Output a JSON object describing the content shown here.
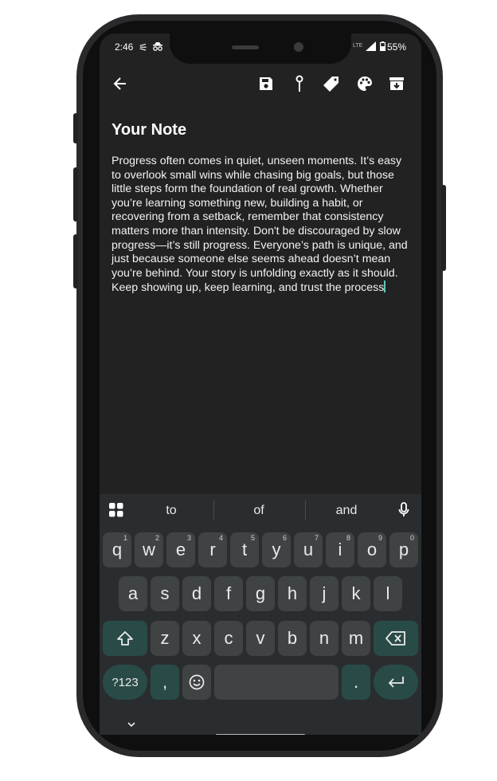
{
  "status_bar": {
    "time": "2:46",
    "network": "LTE",
    "battery": "55%"
  },
  "toolbar": {
    "back_icon": "arrow-back-icon",
    "icons": [
      "save-icon",
      "pin-icon",
      "label-icon",
      "palette-icon",
      "archive-icon"
    ]
  },
  "note": {
    "title": "Your Note",
    "body": "Progress often comes in quiet, unseen moments. It’s easy to overlook small wins while chasing big goals, but those little steps form the foundation of real growth. Whether you’re learning something new, building a habit, or recovering from a setback, remember that consistency matters more than intensity. Don't be discouraged by slow progress—it’s still progress. Everyone’s path is unique, and just because someone else seems ahead doesn’t mean you’re behind. Your story is unfolding exactly as it should. Keep showing up, keep learning, and trust the process"
  },
  "keyboard": {
    "suggestions": [
      "to",
      "of",
      "and"
    ],
    "row1": [
      {
        "k": "q",
        "h": "1"
      },
      {
        "k": "w",
        "h": "2"
      },
      {
        "k": "e",
        "h": "3"
      },
      {
        "k": "r",
        "h": "4"
      },
      {
        "k": "t",
        "h": "5"
      },
      {
        "k": "y",
        "h": "6"
      },
      {
        "k": "u",
        "h": "7"
      },
      {
        "k": "i",
        "h": "8"
      },
      {
        "k": "o",
        "h": "9"
      },
      {
        "k": "p",
        "h": "0"
      }
    ],
    "row2": [
      "a",
      "s",
      "d",
      "f",
      "g",
      "h",
      "j",
      "k",
      "l"
    ],
    "row3": [
      "z",
      "x",
      "c",
      "v",
      "b",
      "n",
      "m"
    ],
    "symbols_label": "?123",
    "comma": ",",
    "period": "."
  },
  "colors": {
    "background": "#222223",
    "keyboard_bg": "#2a2d2f",
    "key_bg": "#3f4344",
    "modifier_bg": "#294b47",
    "caret": "#5cc7b5"
  }
}
